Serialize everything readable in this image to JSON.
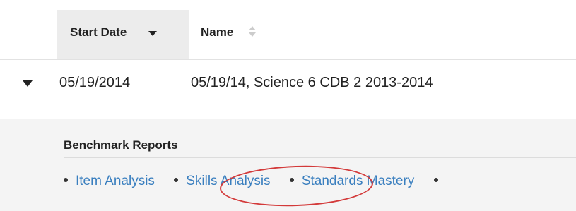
{
  "table": {
    "headers": {
      "start_date": "Start Date",
      "name": "Name"
    },
    "rows": [
      {
        "start_date": "05/19/2014",
        "name": "05/19/14, Science 6 CDB 2 2013-2014",
        "expanded": true
      }
    ]
  },
  "benchmark": {
    "title": "Benchmark Reports",
    "links": [
      "Item Analysis",
      "Skills Analysis",
      "Standards Mastery"
    ]
  },
  "colors": {
    "link": "#3a7fbf",
    "header_bg": "#ececec",
    "panel_bg": "#f4f4f4",
    "annotation": "#d33a3a"
  },
  "icons": {
    "sort_desc": "caret-down-icon",
    "sort_both": "sort-icon",
    "expand": "caret-down-icon"
  }
}
